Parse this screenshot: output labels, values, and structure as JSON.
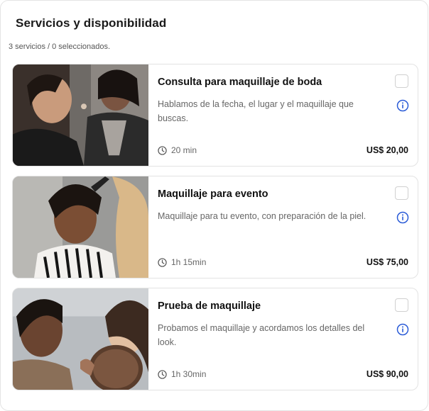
{
  "header": {
    "title": "Servicios y disponibilidad",
    "summary": "3 servicios / 0 seleccionados."
  },
  "services": [
    {
      "name": "Consulta para maquillaje de boda",
      "description": "Hablamos de la fecha, el lugar y el maquillaje que buscas.",
      "duration": "20 min",
      "price": "US$ 20,00",
      "selected": false,
      "icons": {
        "duration": "clock-icon",
        "info": "info-icon"
      }
    },
    {
      "name": "Maquillaje para evento",
      "description": "Maquillaje para tu evento, con preparación de la piel.",
      "duration": "1h 15min",
      "price": "US$ 75,00",
      "selected": false,
      "icons": {
        "duration": "clock-icon",
        "info": "info-icon"
      }
    },
    {
      "name": "Prueba de maquillaje",
      "description": "Probamos el maquillaje y acordamos los detalles del look.",
      "duration": "1h 30min",
      "price": "US$ 90,00",
      "selected": false,
      "icons": {
        "duration": "clock-icon",
        "info": "info-icon"
      }
    }
  ],
  "colors": {
    "accent": "#2a5bd7",
    "border": "#e3e3e3",
    "text_primary": "#111111",
    "text_secondary": "#666666"
  }
}
